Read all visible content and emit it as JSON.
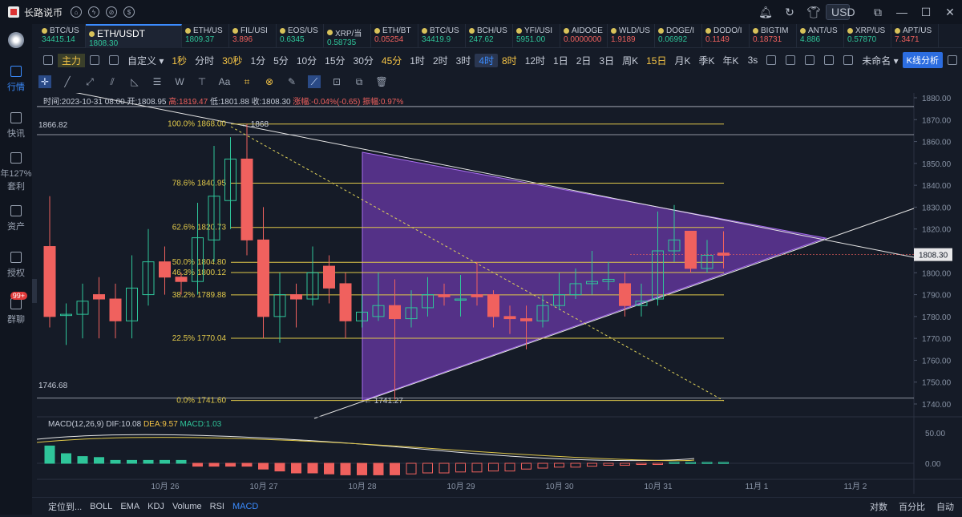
{
  "titlebar": {
    "title": "长路说币",
    "currency": "USD"
  },
  "sidebar": [
    {
      "label": "行情",
      "active": true
    },
    {
      "label": "快讯"
    },
    {
      "label": "年127%\n套利"
    },
    {
      "label": "资产"
    },
    {
      "label": "授权"
    },
    {
      "label": "群聊",
      "badge": "99+"
    }
  ],
  "tickers": [
    {
      "sym": "BTC/US",
      "px": "34415.14",
      "c": "g"
    },
    {
      "sym": "ETH/USDT",
      "px": "1808.30",
      "c": "g",
      "main": true
    },
    {
      "sym": "ETH/US",
      "px": "1809.37",
      "c": "g"
    },
    {
      "sym": "FIL/USI",
      "px": "3.896",
      "c": "r"
    },
    {
      "sym": "EOS/US",
      "px": "0.6345",
      "c": "g"
    },
    {
      "sym": "XRP/当",
      "px": "0.58735",
      "c": "g"
    },
    {
      "sym": "ETH/BT",
      "px": "0.05254",
      "c": "r"
    },
    {
      "sym": "BTC/US",
      "px": "34419.9",
      "c": "g"
    },
    {
      "sym": "BCH/US",
      "px": "247.62",
      "c": "g"
    },
    {
      "sym": "YFI/USI",
      "px": "5951.00",
      "c": "g"
    },
    {
      "sym": "AIDOGE",
      "px": "0.0000000",
      "c": "r"
    },
    {
      "sym": "WLD/US",
      "px": "1.9189",
      "c": "r"
    },
    {
      "sym": "DOGE/I",
      "px": "0.06992",
      "c": "g"
    },
    {
      "sym": "DODO/I",
      "px": "0.1149",
      "c": "r"
    },
    {
      "sym": "BIGTIM",
      "px": "0.18731",
      "c": "r"
    },
    {
      "sym": "ANT/US",
      "px": "4.886",
      "c": "g"
    },
    {
      "sym": "XRP/US",
      "px": "0.57870",
      "c": "g"
    },
    {
      "sym": "APT/US",
      "px": "7.3471",
      "c": "r"
    }
  ],
  "toolbar1": {
    "main": "主力",
    "custom": "自定义",
    "timeframes": [
      {
        "t": "1秒",
        "y": true
      },
      {
        "t": "分时"
      },
      {
        "t": "30秒",
        "y": true
      },
      {
        "t": "1分"
      },
      {
        "t": "5分"
      },
      {
        "t": "10分"
      },
      {
        "t": "15分"
      },
      {
        "t": "30分"
      },
      {
        "t": "45分",
        "y": true
      },
      {
        "t": "1时"
      },
      {
        "t": "2时"
      },
      {
        "t": "3时"
      },
      {
        "t": "4时",
        "sel": true
      },
      {
        "t": "8时",
        "y": true
      },
      {
        "t": "12时"
      },
      {
        "t": "1日"
      },
      {
        "t": "2日"
      },
      {
        "t": "3日"
      },
      {
        "t": "周K"
      },
      {
        "t": "15日",
        "y": true
      },
      {
        "t": "月K"
      },
      {
        "t": "季K"
      },
      {
        "t": "年K"
      }
    ],
    "interval": "3s",
    "layout": "未命名",
    "kline": "K线分析"
  },
  "ohlc": {
    "time": "时间:2023-10-31 08:00",
    "open": "开:1808.95",
    "high": "高:1819.47",
    "low": "低:1801.88",
    "close": "收:1808.30",
    "chg": "涨幅:-0.04%(-0.65)",
    "amp": "振幅:0.97%"
  },
  "labels": {
    "hi": "1866.82",
    "lo": "1746.68",
    "peak": "1868",
    "trough": "1741.27"
  },
  "fib": [
    {
      "label": "100.0% 1868.00",
      "price": 1868.0
    },
    {
      "label": "78.6% 1840.95",
      "price": 1840.95
    },
    {
      "label": "62.6% 1820.73",
      "price": 1820.73
    },
    {
      "label": "50.0% 1804.80",
      "price": 1804.8
    },
    {
      "label": "46.3% 1800.12",
      "price": 1800.12
    },
    {
      "label": "38.2% 1789.88",
      "price": 1789.88
    },
    {
      "label": "22.5% 1770.04",
      "price": 1770.04
    },
    {
      "label": "0.0% 1741.60",
      "price": 1741.6
    }
  ],
  "price_axis": [
    "1880.00",
    "1870.00",
    "1860.00",
    "1850.00",
    "1840.00",
    "1830.00",
    "1820.00",
    "1810.00",
    "1800.00",
    "1790.00",
    "1780.00",
    "1770.00",
    "1760.00",
    "1750.00",
    "1740.00"
  ],
  "current_price": "1808.30",
  "macd": {
    "label": "MACD(12,26,9)",
    "dif": "DIF:10.08",
    "dea": "DEA:9.57",
    "macd": "MACD:1.03",
    "axis": [
      "50.00",
      "0.00"
    ]
  },
  "dates": [
    "10月 26",
    "10月 27",
    "10月 28",
    "10月 29",
    "10月 30",
    "10月 31",
    "11月 1",
    "11月 2"
  ],
  "bottom": {
    "locate": "定位到...",
    "indicators": [
      "BOLL",
      "EMA",
      "KDJ",
      "Volume",
      "RSI",
      "MACD"
    ],
    "right": [
      "对数",
      "百分比",
      "自动"
    ]
  },
  "chart_data": {
    "type": "candlestick",
    "candles": [
      [
        1812,
        1780,
        1835,
        1775
      ],
      [
        1781,
        1781,
        1786,
        1767
      ],
      [
        1781,
        1787,
        1795,
        1770
      ],
      [
        1790,
        1788,
        1798,
        1770
      ],
      [
        1788,
        1778,
        1795,
        1770
      ],
      [
        1778,
        1793,
        1808,
        1770
      ],
      [
        1790,
        1805,
        1820,
        1785
      ],
      [
        1805,
        1798,
        1812,
        1790
      ],
      [
        1798,
        1796,
        1800,
        1790
      ],
      [
        1796,
        1816,
        1832,
        1790
      ],
      [
        1815,
        1835,
        1858,
        1805
      ],
      [
        1833,
        1852,
        1862,
        1820
      ],
      [
        1852,
        1815,
        1868,
        1808
      ],
      [
        1815,
        1780,
        1830,
        1770
      ],
      [
        1780,
        1790,
        1800,
        1768
      ],
      [
        1790,
        1788,
        1795,
        1775
      ],
      [
        1788,
        1800,
        1812,
        1785
      ],
      [
        1803,
        1793,
        1808,
        1786
      ],
      [
        1795,
        1778,
        1800,
        1770
      ],
      [
        1778,
        1782,
        1790,
        1775
      ],
      [
        1780,
        1785,
        1800,
        1778
      ],
      [
        1785,
        1779,
        1797,
        1742
      ],
      [
        1779,
        1784,
        1792,
        1775
      ],
      [
        1784,
        1790,
        1798,
        1780
      ],
      [
        1790,
        1789,
        1795,
        1785
      ],
      [
        1788,
        1788,
        1799,
        1780
      ],
      [
        1790,
        1789,
        1805,
        1785
      ],
      [
        1790,
        1780,
        1792,
        1775
      ],
      [
        1780,
        1779,
        1785,
        1772
      ],
      [
        1779,
        1778,
        1785,
        1765
      ],
      [
        1778,
        1785,
        1790,
        1775
      ],
      [
        1785,
        1790,
        1800,
        1783
      ],
      [
        1790,
        1795,
        1802,
        1788
      ],
      [
        1795,
        1796,
        1810,
        1790
      ],
      [
        1796,
        1797,
        1805,
        1792
      ],
      [
        1795,
        1785,
        1800,
        1780
      ],
      [
        1785,
        1787,
        1795,
        1780
      ],
      [
        1788,
        1810,
        1828,
        1785
      ],
      [
        1810,
        1815,
        1831,
        1805
      ],
      [
        1819,
        1802,
        1819,
        1800
      ],
      [
        1802,
        1808,
        1815,
        1800
      ],
      [
        1809,
        1808,
        1819,
        1802
      ]
    ],
    "macd_hist": [
      18,
      10,
      7,
      6,
      3,
      3,
      3,
      3,
      3,
      -3,
      -3,
      -3,
      -3,
      -6,
      -8,
      -10,
      -10,
      -11,
      -12,
      -12,
      -12,
      -12,
      -11,
      -10,
      -10,
      -9,
      -9,
      -8,
      -8,
      -6,
      -5,
      -4,
      -4,
      -3,
      -2,
      -2,
      -1,
      -1,
      1,
      1,
      1,
      1
    ]
  }
}
